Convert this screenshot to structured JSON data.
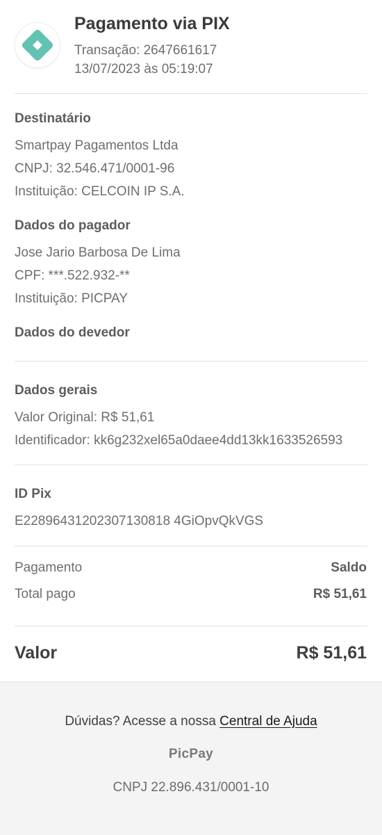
{
  "header": {
    "title": "Pagamento via PIX",
    "transaction": "Transação: 2647661617",
    "datetime": "13/07/2023 às 05:19:07",
    "logo_icon": "pix-logo-icon",
    "accent": "#62c2b3"
  },
  "recipient": {
    "title": "Destinatário",
    "name": "Smartpay Pagamentos Ltda",
    "document": "CNPJ: 32.546.471/0001-96",
    "institution": "Instituição: CELCOIN IP S.A."
  },
  "payer": {
    "title": "Dados do pagador",
    "name": "Jose Jario Barbosa De Lima",
    "document": "CPF: ***.522.932-**",
    "institution": "Instituição: PICPAY"
  },
  "debtor": {
    "title": "Dados do devedor"
  },
  "general": {
    "title": "Dados gerais",
    "original_value": "Valor Original: R$ 51,61",
    "identifier": "Identificador: kk6g232xel65a0daee4dd13kk1633526593"
  },
  "pix_id": {
    "title": "ID Pix",
    "value": "E22896431202307130818 4GiOpvQkVGS"
  },
  "payment": {
    "method_label": "Pagamento",
    "method_value": "Saldo",
    "total_label": "Total pago",
    "total_value": "R$ 51,61"
  },
  "summary": {
    "label": "Valor",
    "value": "R$ 51,61"
  },
  "footer": {
    "help_text": "Dúvidas? Acesse a nossa ",
    "help_link": "Central de Ajuda",
    "brand": "PicPay",
    "cnpj": "CNPJ 22.896.431/0001-10"
  }
}
